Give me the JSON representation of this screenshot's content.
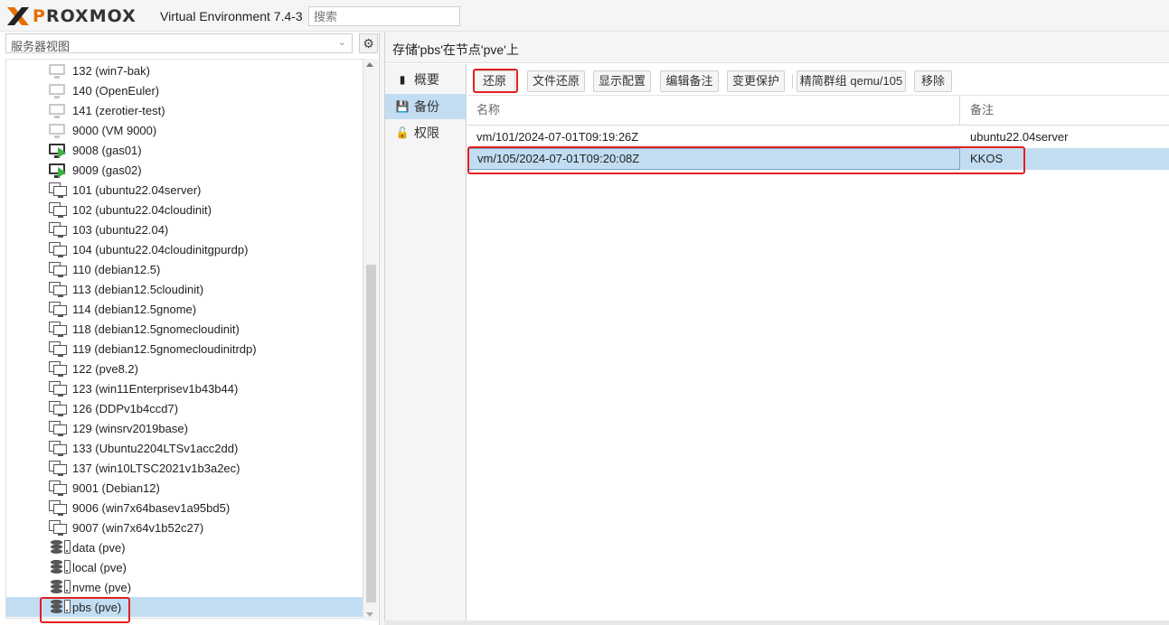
{
  "header": {
    "logo_text": "PROXMOX",
    "title": "Virtual Environment 7.4-3",
    "search_placeholder": "搜索"
  },
  "left_panel": {
    "view_select": "服务器视图",
    "gear_icon": "gear-icon",
    "tree": [
      {
        "label": "132 (win7-bak)",
        "icon": "vm-stopped"
      },
      {
        "label": "140 (OpenEuler)",
        "icon": "vm-stopped"
      },
      {
        "label": "141 (zerotier-test)",
        "icon": "vm-stopped"
      },
      {
        "label": "9000 (VM 9000)",
        "icon": "vm-stopped"
      },
      {
        "label": "9008 (gas01)",
        "icon": "vm-running"
      },
      {
        "label": "9009 (gas02)",
        "icon": "vm-running"
      },
      {
        "label": "101 (ubuntu22.04server)",
        "icon": "template"
      },
      {
        "label": "102 (ubuntu22.04cloudinit)",
        "icon": "template"
      },
      {
        "label": "103 (ubuntu22.04)",
        "icon": "template"
      },
      {
        "label": "104 (ubuntu22.04cloudinitgpurdp)",
        "icon": "template"
      },
      {
        "label": "110 (debian12.5)",
        "icon": "template"
      },
      {
        "label": "113 (debian12.5cloudinit)",
        "icon": "template"
      },
      {
        "label": "114 (debian12.5gnome)",
        "icon": "template"
      },
      {
        "label": "118 (debian12.5gnomecloudinit)",
        "icon": "template"
      },
      {
        "label": "119 (debian12.5gnomecloudinitrdp)",
        "icon": "template"
      },
      {
        "label": "122 (pve8.2)",
        "icon": "template"
      },
      {
        "label": "123 (win11Enterprisev1b43b44)",
        "icon": "template"
      },
      {
        "label": "126 (DDPv1b4ccd7)",
        "icon": "template"
      },
      {
        "label": "129 (winsrv2019base)",
        "icon": "template"
      },
      {
        "label": "133 (Ubuntu2204LTSv1acc2dd)",
        "icon": "template"
      },
      {
        "label": "137 (win10LTSC2021v1b3a2ec)",
        "icon": "template"
      },
      {
        "label": "9001 (Debian12)",
        "icon": "template"
      },
      {
        "label": "9006 (win7x64basev1a95bd5)",
        "icon": "template"
      },
      {
        "label": "9007 (win7x64v1b52c27)",
        "icon": "template"
      },
      {
        "label": "data (pve)",
        "icon": "storage"
      },
      {
        "label": "local (pve)",
        "icon": "storage"
      },
      {
        "label": "nvme (pve)",
        "icon": "storage"
      },
      {
        "label": "pbs (pve)",
        "icon": "storage",
        "selected": true
      }
    ]
  },
  "right_panel": {
    "title": "存储'pbs'在节点'pve'上",
    "tabs": [
      {
        "label": "概要",
        "icon": "book-icon"
      },
      {
        "label": "备份",
        "icon": "floppy-icon",
        "active": true
      },
      {
        "label": "权限",
        "icon": "unlock-icon"
      }
    ],
    "toolbar": {
      "restore": "还原",
      "file_restore": "文件还原",
      "show_config": "显示配置",
      "edit_notes": "编辑备注",
      "change_protection": "变更保护",
      "prune_group": "精简群组 qemu/105",
      "remove": "移除"
    },
    "grid": {
      "columns": [
        "名称",
        "备注"
      ],
      "rows": [
        {
          "name": "vm/101/2024-07-01T09:19:26Z",
          "notes": "ubuntu22.04server"
        },
        {
          "name": "vm/105/2024-07-01T09:20:08Z",
          "notes": "KKOS",
          "selected": true
        }
      ]
    }
  }
}
